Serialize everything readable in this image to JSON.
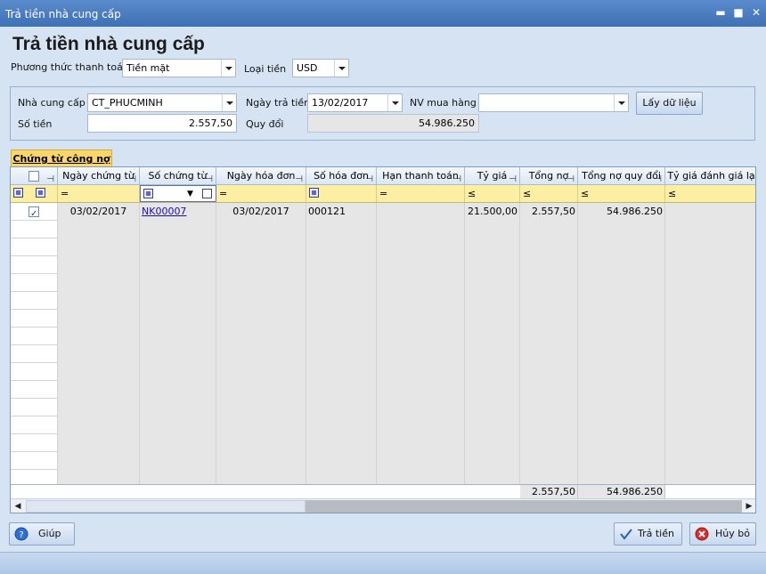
{
  "window": {
    "title": "Trả tiền nhà cung cấp",
    "minimize": "▬",
    "maximize": "■",
    "close": "✕"
  },
  "heading": "Trả tiền nhà cung cấp",
  "payment_method": {
    "label": "Phương thức thanh toán",
    "value": "Tiền mặt"
  },
  "currency": {
    "label": "Loại tiền",
    "value": "USD"
  },
  "supplier": {
    "label": "Nhà cung cấp",
    "value": "CT_PHUCMINH"
  },
  "pay_date": {
    "label": "Ngày trả tiền",
    "value": "13/02/2017"
  },
  "buyer": {
    "label": "NV mua hàng",
    "value": ""
  },
  "fetch_button": "Lấy dữ liệu",
  "amount": {
    "label": "Số tiền",
    "value": "2.557,50"
  },
  "converted": {
    "label": "Quy đổi",
    "value": "54.986.250"
  },
  "tab_label": "Chứng từ công nợ",
  "grid": {
    "columns": [
      "Ngày chứng từ",
      "Số chứng từ",
      "Ngày hóa đơn",
      "Số hóa đơn",
      "Hạn thanh toán",
      "Tỷ giá",
      "Tổng nợ",
      "Tổng nợ quy đổi",
      "Tỷ giá đánh giá lạ"
    ],
    "filter_ops": [
      "=",
      "=",
      "=",
      "≤",
      "≤",
      "≤",
      "≤"
    ],
    "rows": [
      {
        "checked": true,
        "voucher_date": "03/02/2017",
        "voucher_no": "NK00007",
        "invoice_date": "03/02/2017",
        "invoice_no": "000121",
        "due_date": "",
        "rate": "21.500,00",
        "total_debt": "2.557,50",
        "total_converted": "54.986.250",
        "reval_rate": ""
      }
    ],
    "totals": {
      "total_debt": "2.557,50",
      "total_converted": "54.986.250"
    }
  },
  "help_button": "Giúp",
  "pay_button": "Trả tiền",
  "cancel_button": "Hủy bỏ"
}
